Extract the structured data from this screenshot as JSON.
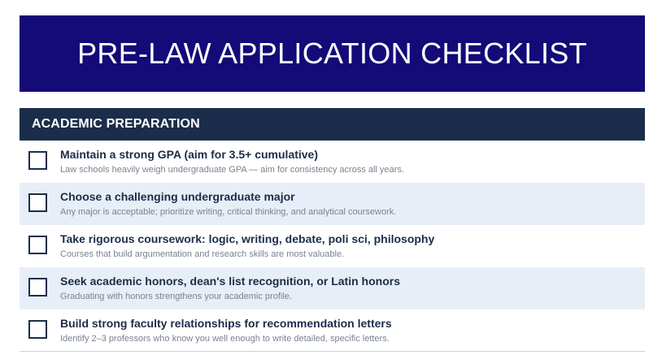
{
  "header": {
    "title": "PRE-LAW APPLICATION CHECKLIST"
  },
  "section": {
    "title": "ACADEMIC PREPARATION",
    "items": [
      {
        "title": "Maintain a strong GPA (aim for 3.5+ cumulative)",
        "description": "Law schools heavily weigh undergraduate GPA — aim for consistency across all years.",
        "checked": false
      },
      {
        "title": "Choose a challenging undergraduate major",
        "description": "Any major is acceptable; prioritize writing, critical thinking, and analytical coursework.",
        "checked": false
      },
      {
        "title": "Take rigorous coursework: logic, writing, debate, poli sci, philosophy",
        "description": "Courses that build argumentation and research skills are most valuable.",
        "checked": false
      },
      {
        "title": "Seek academic honors, dean's list recognition, or Latin honors",
        "description": "Graduating with honors strengthens your academic profile.",
        "checked": false
      },
      {
        "title": "Build strong faculty relationships for recommendation letters",
        "description": "Identify 2–3 professors who know you well enough to write detailed, specific letters.",
        "checked": false
      }
    ]
  },
  "colors": {
    "banner": "#140a78",
    "section_header": "#1b2d4a",
    "alt_row": "#e8eef7",
    "title_text": "#1b2d4a",
    "description_text": "#7a8290"
  }
}
